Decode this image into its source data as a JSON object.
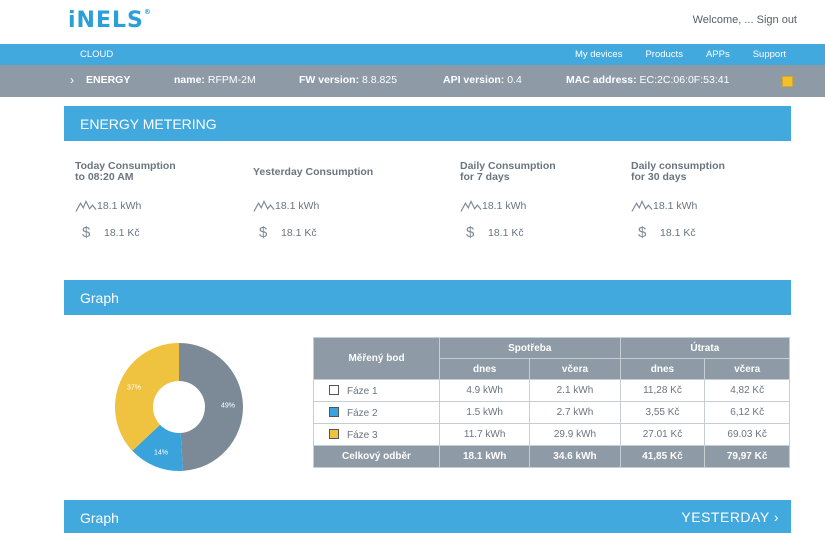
{
  "header": {
    "logo": "iNELS",
    "welcome_text": "Welcome, ...",
    "signout_label": "Sign out"
  },
  "nav": {
    "cloud_label": "CLOUD",
    "links": [
      "My devices",
      "Products",
      "APPs",
      "Support"
    ]
  },
  "device": {
    "section": "ENERGY",
    "name_label": "name:",
    "name_value": "RFPM-2M",
    "fw_label": "FW version:",
    "fw_value": "8.8.825",
    "api_label": "API version:",
    "api_value": "0.4",
    "mac_label": "MAC address:",
    "mac_value": "EC:2C:06:0F:53:41",
    "status_color": "#f0c030"
  },
  "energy": {
    "title": "ENERGY METERING",
    "stats": [
      {
        "label_line1": "Today Consumption",
        "label_line2": "to 08:20 AM",
        "energy": "18.1 kWh",
        "cost": "18.1 Kč"
      },
      {
        "label_line1": "Yesterday Consumption",
        "label_line2": "",
        "energy": "18.1 kWh",
        "cost": "18.1 Kč"
      },
      {
        "label_line1": "Daily Consumption",
        "label_line2": "for 7 days",
        "energy": "18.1 kWh",
        "cost": "18.1 Kč"
      },
      {
        "label_line1": "Daily consumption",
        "label_line2": "for 30 days",
        "energy": "18.1 kWh",
        "cost": "18.1 Kč"
      }
    ]
  },
  "graph": {
    "title": "Graph",
    "title2": "Graph",
    "period_label": "YESTERDAY"
  },
  "chart_data": {
    "type": "pie",
    "categories": [
      "Fáze 1",
      "Fáze 2",
      "Fáze 3"
    ],
    "values": [
      49,
      14,
      37
    ],
    "labels": [
      "49%",
      "14%",
      "37%"
    ],
    "colors": [
      "#7c8a98",
      "#3ba3db",
      "#efc23f"
    ]
  },
  "table": {
    "col_point": "Měřený bod",
    "col_consumption": "Spotřeba",
    "col_cost": "Útrata",
    "sub_today": "dnes",
    "sub_yesterday": "včera",
    "rows": [
      {
        "name": "Fáze 1",
        "color": "#ffffff",
        "c_today": "4.9 kWh",
        "c_yesterday": "2.1 kWh",
        "p_today": "11,28 Kč",
        "p_yesterday": "4,82 Kč"
      },
      {
        "name": "Fáze 2",
        "color": "#3ba3db",
        "c_today": "1.5 kWh",
        "c_yesterday": "2.7 kWh",
        "p_today": "3,55 Kč",
        "p_yesterday": "6,12 Kč"
      },
      {
        "name": "Fáze 3",
        "color": "#efc23f",
        "c_today": "11.7 kWh",
        "c_yesterday": "29.9 kWh",
        "p_today": "27.01 Kč",
        "p_yesterday": "69.03 Kč"
      }
    ],
    "total": {
      "name": "Celkový odběr",
      "c_today": "18.1 kWh",
      "c_yesterday": "34.6 kWh",
      "p_today": "41,85 Kč",
      "p_yesterday": "79,97 Kč"
    }
  }
}
